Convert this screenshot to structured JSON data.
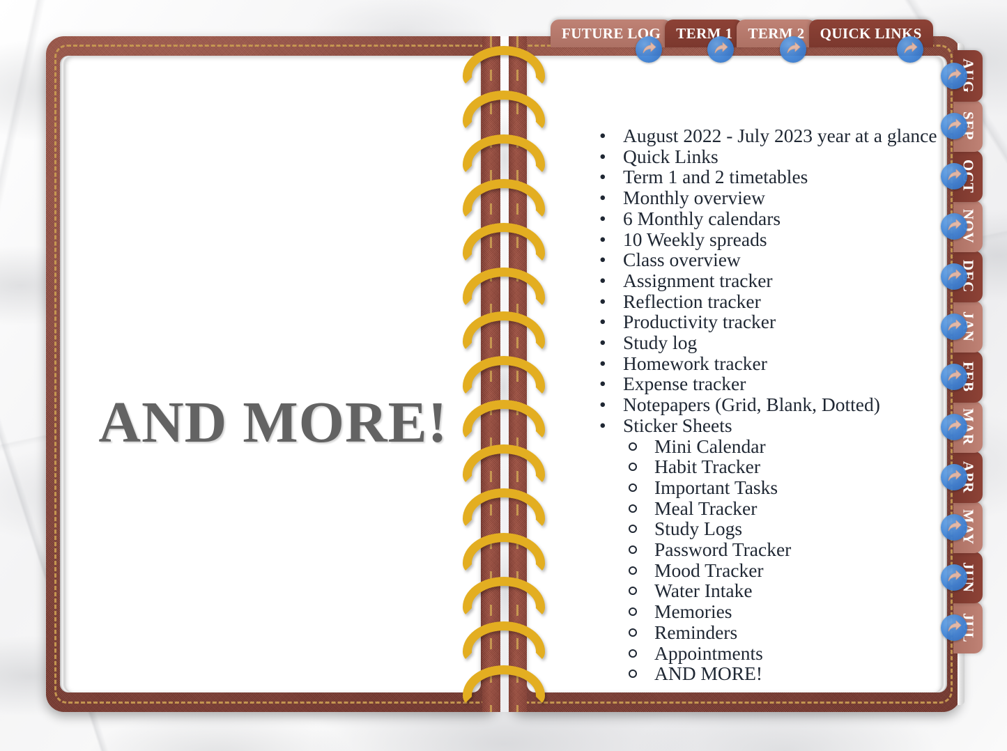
{
  "background": {
    "style": "white-marble",
    "color": "#f4f4f5"
  },
  "notebook": {
    "cover_color": "#9d4c3e",
    "stitch_color": "#c89a52",
    "spiral_color": "#e3ae21",
    "ring_count": 15
  },
  "left_page": {
    "headline": "AND MORE!",
    "headline_color": "#636363"
  },
  "right_page": {
    "text_color": "#1f2733",
    "items": [
      "August 2022 - July 2023 year at a glance",
      "Quick Links",
      "Term 1 and 2 timetables",
      "Monthly overview",
      "6 Monthly calendars",
      "10 Weekly spreads",
      "Class overview",
      "Assignment tracker",
      "Reflection tracker",
      "Productivity tracker",
      "Study log",
      "Homework tracker",
      "Expense tracker",
      "Notepapers (Grid, Blank, Dotted)",
      "Sticker Sheets"
    ],
    "bullet_glyph": "•",
    "sub_items": [
      "Mini Calendar",
      "Habit Tracker",
      "Important Tasks",
      "Meal Tracker",
      "Study Logs",
      "Password Tracker",
      "Mood Tracker",
      "Water Intake",
      "Memories",
      "Reminders",
      "Appointments",
      "AND MORE!"
    ]
  },
  "top_tabs": [
    {
      "label": "FUTURE LOG",
      "tone": "light",
      "icon": "arrow-right-icon"
    },
    {
      "label": "TERM 1",
      "tone": "dark",
      "icon": "arrow-right-icon"
    },
    {
      "label": "TERM 2",
      "tone": "light",
      "icon": "arrow-right-icon"
    },
    {
      "label": "QUICK LINKS",
      "tone": "dark",
      "icon": "arrow-right-icon"
    }
  ],
  "month_tabs": [
    {
      "label": "AUG",
      "tone": "dark",
      "icon": "arrow-right-icon"
    },
    {
      "label": "SEP",
      "tone": "light",
      "icon": "arrow-right-icon"
    },
    {
      "label": "OCT",
      "tone": "dark",
      "icon": "arrow-right-icon"
    },
    {
      "label": "NOV",
      "tone": "light",
      "icon": "arrow-right-icon"
    },
    {
      "label": "DEC",
      "tone": "dark",
      "icon": "arrow-right-icon"
    },
    {
      "label": "JAN",
      "tone": "light",
      "icon": "arrow-right-icon"
    },
    {
      "label": "FEB",
      "tone": "dark",
      "icon": "arrow-right-icon"
    },
    {
      "label": "MAR",
      "tone": "light",
      "icon": "arrow-right-icon"
    },
    {
      "label": "APR",
      "tone": "dark",
      "icon": "arrow-right-icon"
    },
    {
      "label": "MAY",
      "tone": "light",
      "icon": "arrow-right-icon"
    },
    {
      "label": "JUN",
      "tone": "dark",
      "icon": "arrow-right-icon"
    },
    {
      "label": "JUL",
      "tone": "light",
      "icon": "arrow-right-icon"
    }
  ],
  "colors": {
    "tab_light": "#b0766a",
    "tab_dark": "#85402f",
    "badge_blue": "#3d82d6",
    "badge_arrow": "#e8bfae"
  }
}
